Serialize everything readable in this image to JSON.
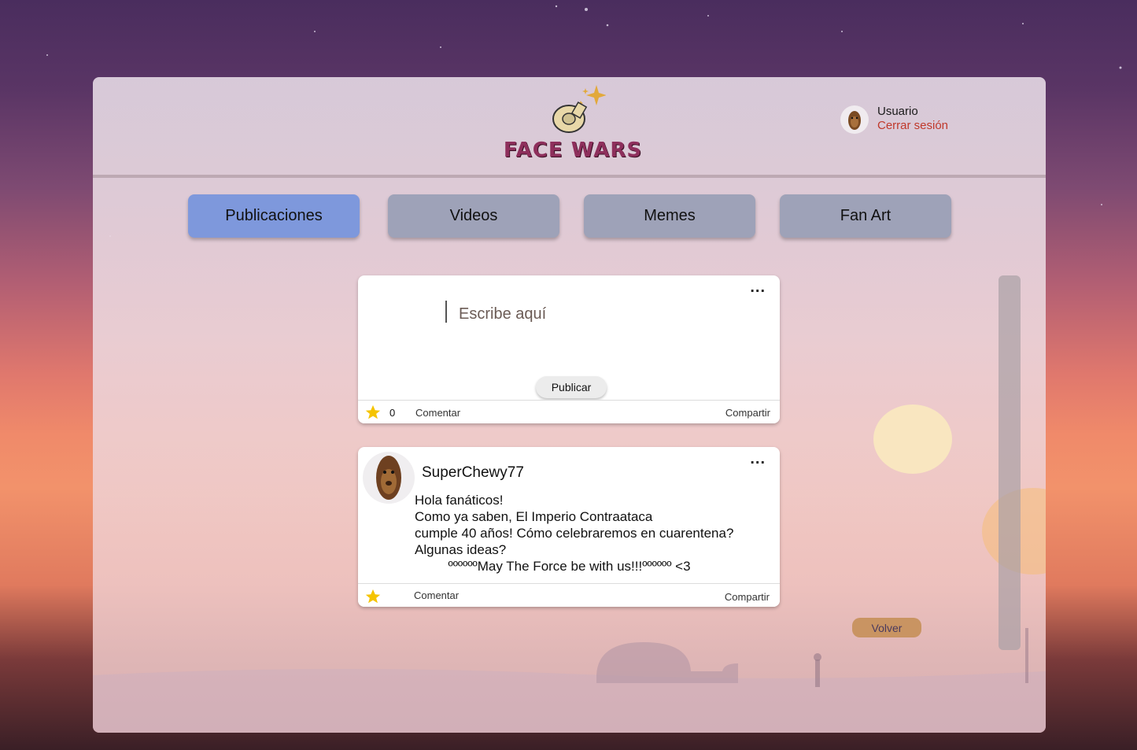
{
  "app": {
    "logo_text": "FACE WARS"
  },
  "user": {
    "name": "Usuario",
    "logout_label": "Cerrar sesión"
  },
  "tabs": [
    {
      "label": "Publicaciones",
      "active": true
    },
    {
      "label": "Videos",
      "active": false
    },
    {
      "label": "Memes",
      "active": false
    },
    {
      "label": "Fan Art",
      "active": false
    }
  ],
  "composer": {
    "placeholder": "Escribe aquí",
    "publish_label": "Publicar",
    "menu_icon": "more-horizontal-icon",
    "likes": "0",
    "comment_label": "Comentar",
    "share_label": "Compartir"
  },
  "post": {
    "author": "SuperChewy77",
    "body": "Hola fanáticos!\nComo ya saben, El Imperio Contraataca\ncumple 40 años! Cómo celebraremos en cuarentena?\nAlgunas ideas?\n         ººººººMay The Force be with us!!!ºººººº <3",
    "comment_label": "Comentar",
    "share_label": "Compartir"
  },
  "back_label": "Volver",
  "colors": {
    "active_tab": "#7e98dc",
    "inactive_tab": "#9ea2b8",
    "logout": "#c0392b",
    "star": "#f5c400",
    "back_button": "#c99462"
  }
}
